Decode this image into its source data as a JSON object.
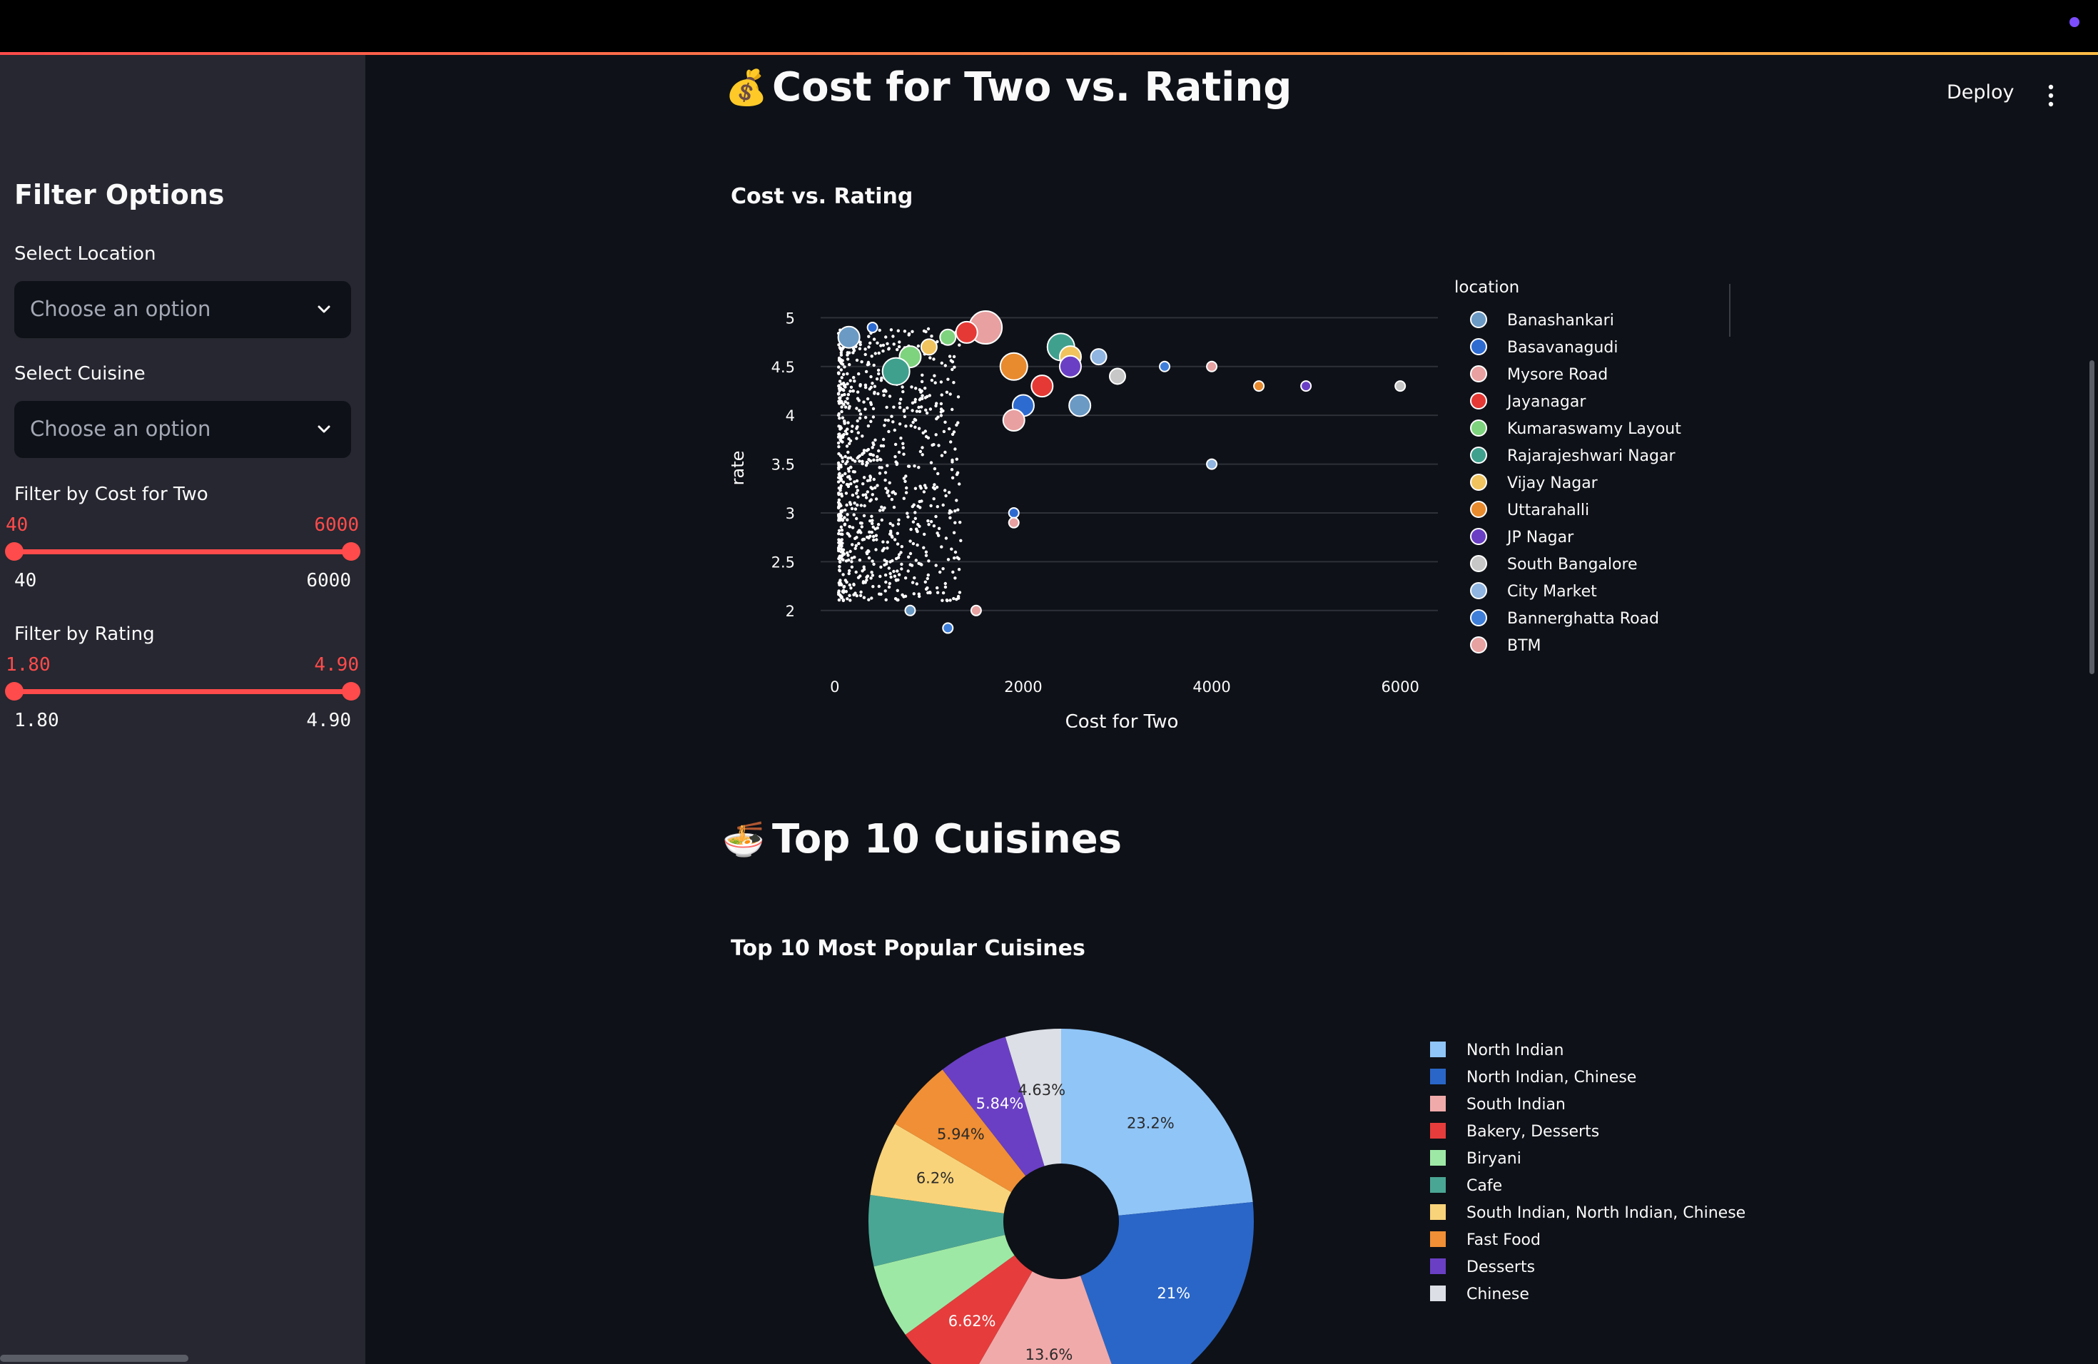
{
  "app": {
    "deploy_label": "Deploy",
    "menu_icon": "more-vert-icon"
  },
  "sidebar": {
    "heading": "Filter Options",
    "location": {
      "label": "Select Location",
      "placeholder": "Choose an option"
    },
    "cuisine": {
      "label": "Select Cuisine",
      "placeholder": "Choose an option"
    },
    "cost_slider": {
      "label": "Filter by Cost for Two",
      "min_value": "40",
      "max_value": "6000",
      "min_bound": "40",
      "max_bound": "6000",
      "fill_low": 0,
      "fill_high": 1
    },
    "rating_slider": {
      "label": "Filter by Rating",
      "min_value": "1.80",
      "max_value": "4.90",
      "min_bound": "1.80",
      "max_bound": "4.90",
      "fill_low": 0,
      "fill_high": 1
    }
  },
  "sections": {
    "cost_rating": {
      "emoji": "💰",
      "title": "Cost for Two vs. Rating"
    },
    "cuisines": {
      "emoji": "🍜",
      "title": "Top 10 Cuisines"
    }
  },
  "chart_data": [
    {
      "type": "scatter",
      "title": "Cost vs. Rating",
      "xlabel": "Cost for Two",
      "ylabel": "rate",
      "xlim": [
        -150,
        6400
      ],
      "ylim": [
        1.75,
        5.2
      ],
      "x_ticks": [
        "0",
        "2000",
        "4000",
        "6000"
      ],
      "y_ticks": [
        "2",
        "2.5",
        "3",
        "3.5",
        "4",
        "4.5",
        "5"
      ],
      "grid": true,
      "legend_title": "location",
      "legend_position": "right",
      "series": [
        {
          "name": "Banashankari",
          "color": "#6b9ac4"
        },
        {
          "name": "Basavanagudi",
          "color": "#2e6bd1"
        },
        {
          "name": "Mysore Road",
          "color": "#e8a0a0"
        },
        {
          "name": "Jayanagar",
          "color": "#e53935"
        },
        {
          "name": "Kumaraswamy Layout",
          "color": "#7ed37e"
        },
        {
          "name": "Rajarajeshwari Nagar",
          "color": "#3fa08e"
        },
        {
          "name": "Vijay Nagar",
          "color": "#f0c35e"
        },
        {
          "name": "Uttarahalli",
          "color": "#e88a2e"
        },
        {
          "name": "JP Nagar",
          "color": "#6a3fc4"
        },
        {
          "name": "South Bangalore",
          "color": "#c7c7c7"
        },
        {
          "name": "City Market",
          "color": "#8fb5e0"
        },
        {
          "name": "Bannerghatta Road",
          "color": "#3f7fd9"
        },
        {
          "name": "BTM",
          "color": "#e6a1a1"
        }
      ],
      "points": [
        {
          "x": 150,
          "y": 4.8,
          "s": 3
        },
        {
          "x": 400,
          "y": 4.9,
          "s": 1
        },
        {
          "x": 1600,
          "y": 4.9,
          "s": 5
        },
        {
          "x": 1400,
          "y": 4.85,
          "s": 3
        },
        {
          "x": 1200,
          "y": 4.8,
          "s": 2
        },
        {
          "x": 2400,
          "y": 4.7,
          "s": 4
        },
        {
          "x": 2500,
          "y": 4.6,
          "s": 3
        },
        {
          "x": 1900,
          "y": 4.5,
          "s": 4
        },
        {
          "x": 2500,
          "y": 4.5,
          "s": 3
        },
        {
          "x": 3000,
          "y": 4.4,
          "s": 2
        },
        {
          "x": 2800,
          "y": 4.6,
          "s": 2
        },
        {
          "x": 3500,
          "y": 4.5,
          "s": 1
        },
        {
          "x": 4000,
          "y": 4.5,
          "s": 1
        },
        {
          "x": 2600,
          "y": 4.1,
          "s": 3
        },
        {
          "x": 2000,
          "y": 4.1,
          "s": 3
        },
        {
          "x": 1900,
          "y": 3.95,
          "s": 3
        },
        {
          "x": 2200,
          "y": 4.3,
          "s": 3
        },
        {
          "x": 800,
          "y": 4.6,
          "s": 3
        },
        {
          "x": 650,
          "y": 4.45,
          "s": 4
        },
        {
          "x": 1000,
          "y": 4.7,
          "s": 2
        },
        {
          "x": 4500,
          "y": 4.3,
          "s": 1
        },
        {
          "x": 5000,
          "y": 4.3,
          "s": 1
        },
        {
          "x": 6000,
          "y": 4.3,
          "s": 1
        },
        {
          "x": 4000,
          "y": 3.5,
          "s": 1
        },
        {
          "x": 1200,
          "y": 1.82,
          "s": 1
        },
        {
          "x": 1500,
          "y": 2.0,
          "s": 1
        },
        {
          "x": 800,
          "y": 2.0,
          "s": 1
        },
        {
          "x": 1900,
          "y": 3.0,
          "s": 1
        },
        {
          "x": 1900,
          "y": 2.9,
          "s": 1
        }
      ]
    },
    {
      "type": "pie",
      "title": "Top 10 Most Popular Cuisines",
      "hole": 0.3,
      "legend_position": "right",
      "labels": [
        "North Indian",
        "North Indian, Chinese",
        "South Indian",
        "Bakery, Desserts",
        "Biryani",
        "Cafe",
        "South Indian, North Indian, Chinese",
        "Fast Food",
        "Desserts",
        "Chinese"
      ],
      "values": [
        23.2,
        21,
        13.6,
        6.62,
        6.2,
        5.9,
        6.2,
        5.94,
        5.84,
        4.63
      ],
      "slice_labels": [
        "23.2%",
        "21%",
        "13.6%",
        "6.62%",
        "",
        "",
        "6.2%",
        "5.94%",
        "5.84%",
        "4.63%"
      ],
      "colors": [
        "#90c5f7",
        "#2a66c7",
        "#f1aaaa",
        "#e63c3c",
        "#9ee8a6",
        "#4aa694",
        "#f9d37a",
        "#f08f35",
        "#6a3fc4",
        "#dcdfe6"
      ]
    }
  ]
}
